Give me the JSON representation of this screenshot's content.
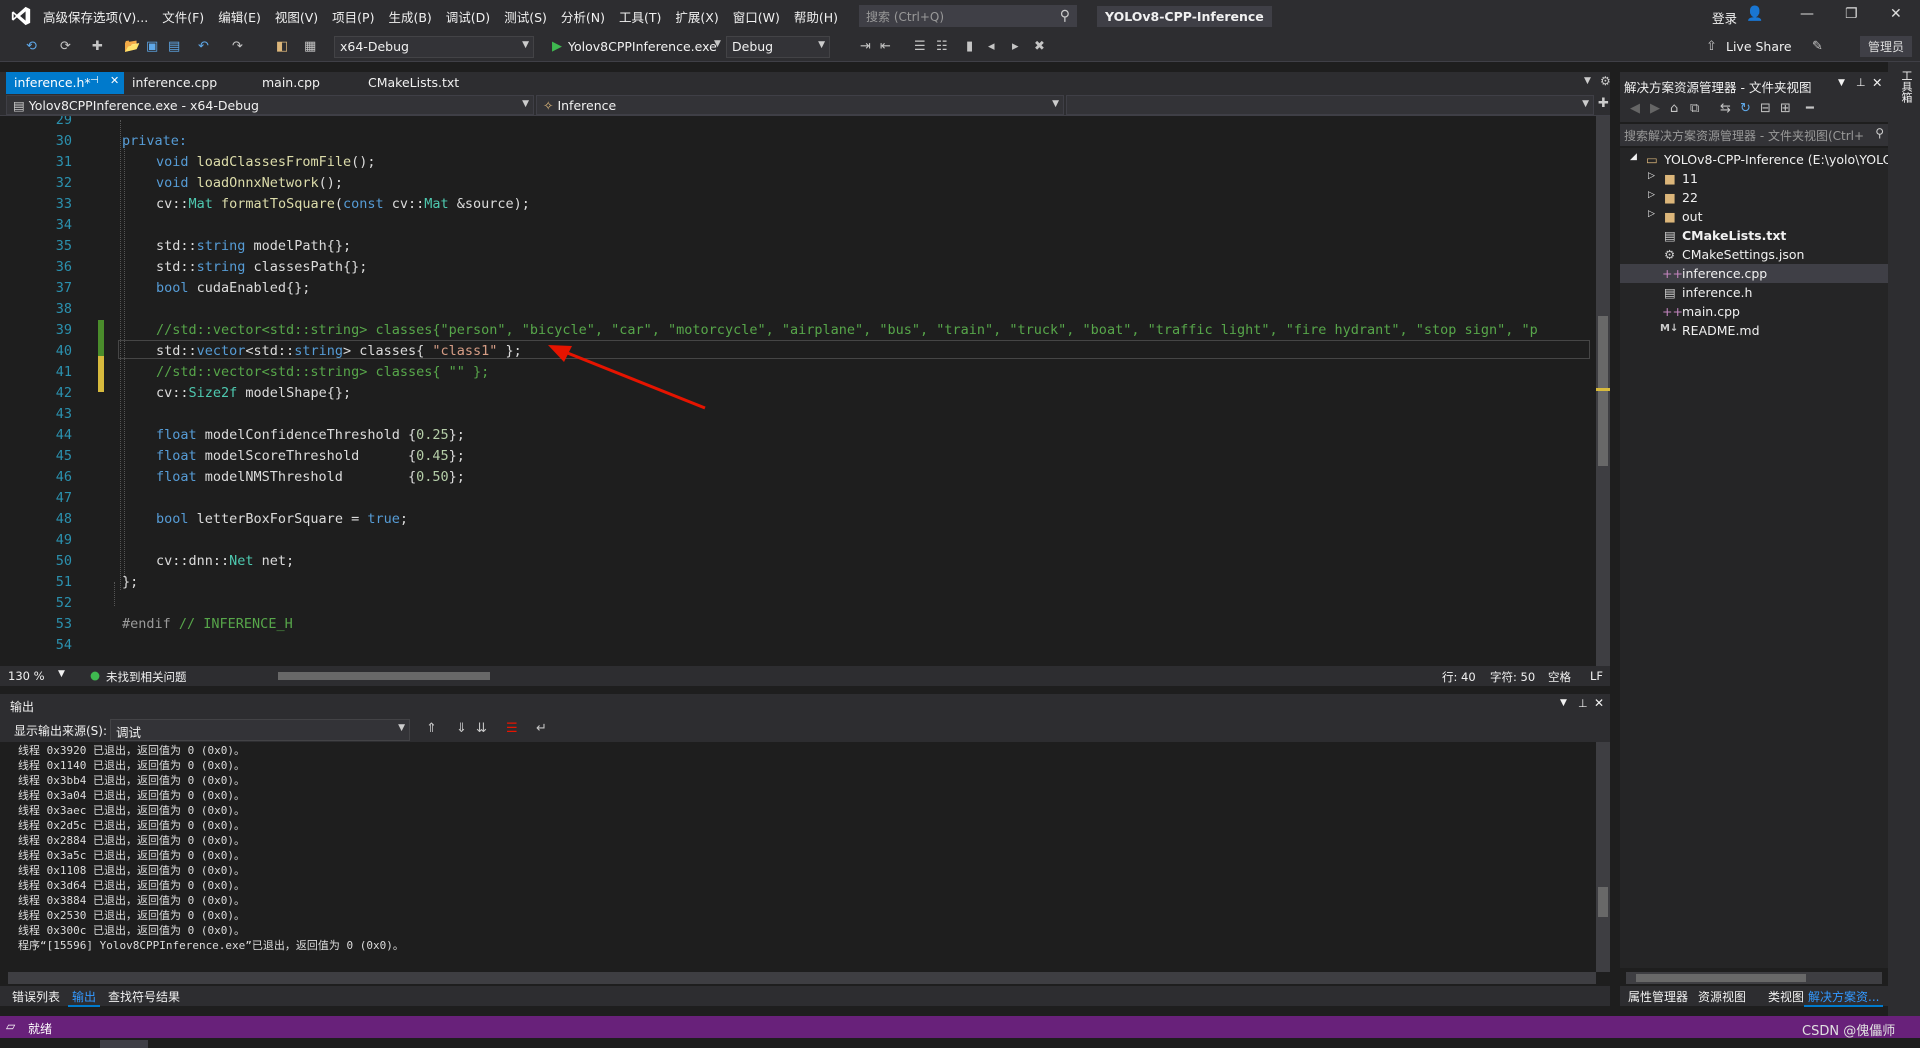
{
  "titlebar": {
    "menu": [
      "高级保存选项(V)...",
      "文件(F)",
      "编辑(E)",
      "视图(V)",
      "项目(P)",
      "生成(B)",
      "调试(D)",
      "测试(S)",
      "分析(N)",
      "工具(T)",
      "扩展(X)",
      "窗口(W)",
      "帮助(H)"
    ],
    "search_placeholder": "搜索 (Ctrl+Q)",
    "project_title": "YOLOv8-CPP-Inference",
    "login_label": "登录"
  },
  "toolbar": {
    "config": "x64-Debug",
    "start_target": "Yolov8CPPInference.exe",
    "build_mode": "Debug",
    "live_share": "Live Share",
    "admin_badge": "管理员"
  },
  "tabs": [
    {
      "label": "inference.h*",
      "active": true
    },
    {
      "label": "inference.cpp",
      "active": false
    },
    {
      "label": "main.cpp",
      "active": false
    },
    {
      "label": "CMakeLists.txt",
      "active": false
    }
  ],
  "navbar": {
    "project": "Yolov8CPPInference.exe - x64-Debug",
    "scope": "Inference"
  },
  "editor": {
    "line_numbers": [
      "29",
      "30",
      "31",
      "32",
      "33",
      "34",
      "35",
      "36",
      "37",
      "38",
      "39",
      "40",
      "41",
      "42",
      "43",
      "44",
      "45",
      "46",
      "47",
      "48",
      "49",
      "50",
      "51",
      "52",
      "53",
      "54"
    ],
    "lines": {
      "l30": "private:",
      "l31_kw": "void",
      "l31_fn": "loadClassesFromFile",
      "l31_rest": "();",
      "l32_kw": "void",
      "l32_fn": "loadOnnxNetwork",
      "l32_rest": "();",
      "l33_a": "cv::",
      "l33_ty": "Mat",
      "l33_fn": "formatToSquare",
      "l33_b": "(",
      "l33_kw": "const",
      "l33_c": " cv::",
      "l33_ty2": "Mat",
      "l33_d": " &source);",
      "l35_a": "std::",
      "l35_ty": "string",
      "l35_b": " modelPath{};",
      "l36_a": "std::",
      "l36_ty": "string",
      "l36_b": " classesPath{};",
      "l37_kw": "bool",
      "l37_b": " cudaEnabled{};",
      "l39": "//std::vector<std::string> classes{\"person\", \"bicycle\", \"car\", \"motorcycle\", \"airplane\", \"bus\", \"train\", \"truck\", \"boat\", \"traffic light\", \"fire hydrant\", \"stop sign\", \"p",
      "l40_a": "std::",
      "l40_ty": "vector",
      "l40_b": "<std::",
      "l40_ty2": "string",
      "l40_c": "> classes{ ",
      "l40_st": "\"class1\"",
      "l40_d": " };",
      "l41": "//std::vector<std::string> classes{ \"\" };",
      "l42_a": "cv::",
      "l42_ty": "Size2f",
      "l42_b": " modelShape{};",
      "l44_kw": "float",
      "l44_b": " modelConfidenceThreshold {",
      "l44_nu": "0.25",
      "l44_c": "};",
      "l45_kw": "float",
      "l45_b": " modelScoreThreshold      {",
      "l45_nu": "0.45",
      "l45_c": "};",
      "l46_kw": "float",
      "l46_b": " modelNMSThreshold        {",
      "l46_nu": "0.50",
      "l46_c": "};",
      "l48_kw": "bool",
      "l48_b": " letterBoxForSquare = ",
      "l48_kw2": "true",
      "l48_c": ";",
      "l50_a": "cv::dnn::",
      "l50_ty": "Net",
      "l50_b": " net;",
      "l51": "};",
      "l53_pp": "#endif",
      "l53_cm": " // INFERENCE_H"
    }
  },
  "statusline": {
    "zoom": "130 %",
    "issues": "未找到相关问题",
    "row": "行: 40",
    "col": "字符: 50",
    "ws": "空格",
    "eol": "LF"
  },
  "output": {
    "title": "输出",
    "source_label": "显示输出来源(S):",
    "source_value": "调试",
    "lines": [
      "线程 0x3920 已退出，返回值为 0 (0x0)。",
      "线程 0x1140 已退出，返回值为 0 (0x0)。",
      "线程 0x3bb4 已退出，返回值为 0 (0x0)。",
      "线程 0x3a04 已退出，返回值为 0 (0x0)。",
      "线程 0x3aec 已退出，返回值为 0 (0x0)。",
      "线程 0x2d5c 已退出，返回值为 0 (0x0)。",
      "线程 0x2884 已退出，返回值为 0 (0x0)。",
      "线程 0x3a5c 已退出，返回值为 0 (0x0)。",
      "线程 0x1108 已退出，返回值为 0 (0x0)。",
      "线程 0x3d64 已退出，返回值为 0 (0x0)。",
      "线程 0x3884 已退出，返回值为 0 (0x0)。",
      "线程 0x2530 已退出，返回值为 0 (0x0)。",
      "线程 0x300c 已退出，返回值为 0 (0x0)。",
      "程序“[15596] Yolov8CPPInference.exe”已退出，返回值为 0 (0x0)。"
    ]
  },
  "bottom_tabs": [
    "错误列表",
    "输出",
    "查找符号结果"
  ],
  "statusbar": {
    "ready": "就绪",
    "watermark": "CSDN @傀儡师"
  },
  "solution_explorer": {
    "title": "解决方案资源管理器 - 文件夹视图",
    "search_placeholder": "搜索解决方案资源管理器 - 文件夹视图(Ctrl+",
    "root": "YOLOv8-CPP-Inference (E:\\yolo\\YOLO",
    "items": [
      "11",
      "22",
      "out",
      "CMakeLists.txt",
      "CMakeSettings.json",
      "inference.cpp",
      "inference.h",
      "main.cpp",
      "README.md"
    ],
    "bottom_tabs": [
      "属性管理器",
      "资源视图",
      "类视图",
      "解决方案资..."
    ]
  },
  "right_strip": {
    "label": "工具箱"
  },
  "colors": {
    "accent": "#007acc",
    "status_purple": "#68217a",
    "arrow_red": "#e51400"
  }
}
